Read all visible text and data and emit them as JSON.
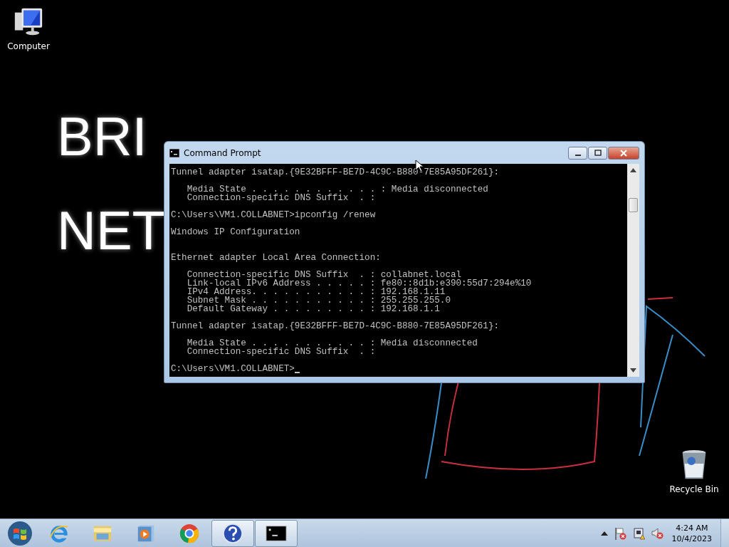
{
  "desktop": {
    "wallpaper_text": [
      "BRI",
      "NET"
    ],
    "icons": [
      {
        "kind": "computer",
        "label": "Computer"
      },
      {
        "kind": "recycle_bin",
        "label": "Recycle Bin"
      }
    ]
  },
  "window": {
    "title": "Command Prompt",
    "console": [
      {
        "kind": "text",
        "text": "Tunnel adapter isatap.{9E32BFFF-BE7D-4C9C-B880-7E85A95DF261}:"
      },
      {
        "kind": "blank"
      },
      {
        "kind": "text",
        "text": "   Media State . . . . . . . . . . . . : Media disconnected"
      },
      {
        "kind": "text",
        "text": "   Connection-specific DNS Suffix  . :"
      },
      {
        "kind": "blank"
      },
      {
        "kind": "text",
        "text": "C:\\Users\\VM1.COLLABNET>ipconfig /renew"
      },
      {
        "kind": "blank"
      },
      {
        "kind": "text",
        "text": "Windows IP Configuration"
      },
      {
        "kind": "blank"
      },
      {
        "kind": "blank"
      },
      {
        "kind": "text",
        "text": "Ethernet adapter Local Area Connection:"
      },
      {
        "kind": "blank"
      },
      {
        "kind": "text",
        "text": "   Connection-specific DNS Suffix  . : collabnet.local"
      },
      {
        "kind": "text",
        "text": "   Link-local IPv6 Address . . . . . : fe80::8d1b:e390:55d7:294e%10"
      },
      {
        "kind": "text",
        "text": "   IPv4 Address. . . . . . . . . . . : 192.168.1.11"
      },
      {
        "kind": "text",
        "text": "   Subnet Mask . . . . . . . . . . . : 255.255.255.0"
      },
      {
        "kind": "text",
        "text": "   Default Gateway . . . . . . . . . : 192.168.1.1"
      },
      {
        "kind": "blank"
      },
      {
        "kind": "text",
        "text": "Tunnel adapter isatap.{9E32BFFF-BE7D-4C9C-B880-7E85A95DF261}:"
      },
      {
        "kind": "blank"
      },
      {
        "kind": "text",
        "text": "   Media State . . . . . . . . . . . : Media disconnected"
      },
      {
        "kind": "text",
        "text": "   Connection-specific DNS Suffix  . :"
      },
      {
        "kind": "blank"
      },
      {
        "kind": "prompt",
        "text": "C:\\Users\\VM1.COLLABNET>"
      }
    ]
  },
  "taskbar": {
    "items": [
      {
        "kind": "start",
        "running": false
      },
      {
        "kind": "ie",
        "running": false
      },
      {
        "kind": "explorer",
        "running": false
      },
      {
        "kind": "media",
        "running": false
      },
      {
        "kind": "chrome",
        "running": false
      },
      {
        "kind": "help",
        "running": true
      },
      {
        "kind": "cmd",
        "running": true
      }
    ],
    "tray": {
      "time": "4:24 AM",
      "date": "10/4/2023"
    }
  }
}
